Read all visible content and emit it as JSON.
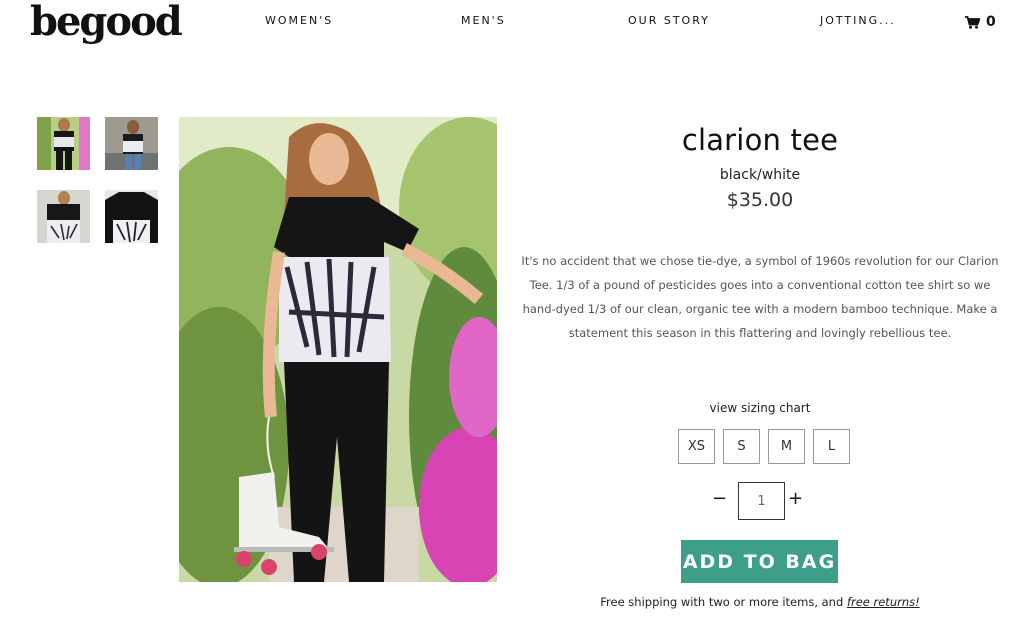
{
  "header": {
    "logo_text": "begood",
    "nav": [
      {
        "label": "WOMEN'S"
      },
      {
        "label": "MEN'S"
      },
      {
        "label": "OUR STORY"
      },
      {
        "label": "JOTTING..."
      }
    ],
    "cart_count": "0",
    "cart_icon": "cart-icon"
  },
  "product": {
    "title": "clarion tee",
    "variant": "black/white",
    "price": "$35.00",
    "description": "It's no accident that we chose tie-dye, a symbol of 1960s revolution for our Clarion Tee. 1/3 of a pound of pesticides goes into a conventional cotton tee shirt so we hand-dyed 1/3 of our clean, organic tee with a modern bamboo technique.  Make a statement this season in this flattering and lovingly rebellious tee.",
    "sizing_link": "view sizing chart",
    "sizes": [
      "XS",
      "S",
      "M",
      "L"
    ],
    "quantity": "1",
    "qty_minus": "−",
    "qty_plus": "+",
    "add_to_bag": "ADD TO BAG",
    "shipping_text": "Free shipping with two or more items, and ",
    "returns_link": "free returns!"
  },
  "colors": {
    "accent": "#3d9e8a"
  }
}
